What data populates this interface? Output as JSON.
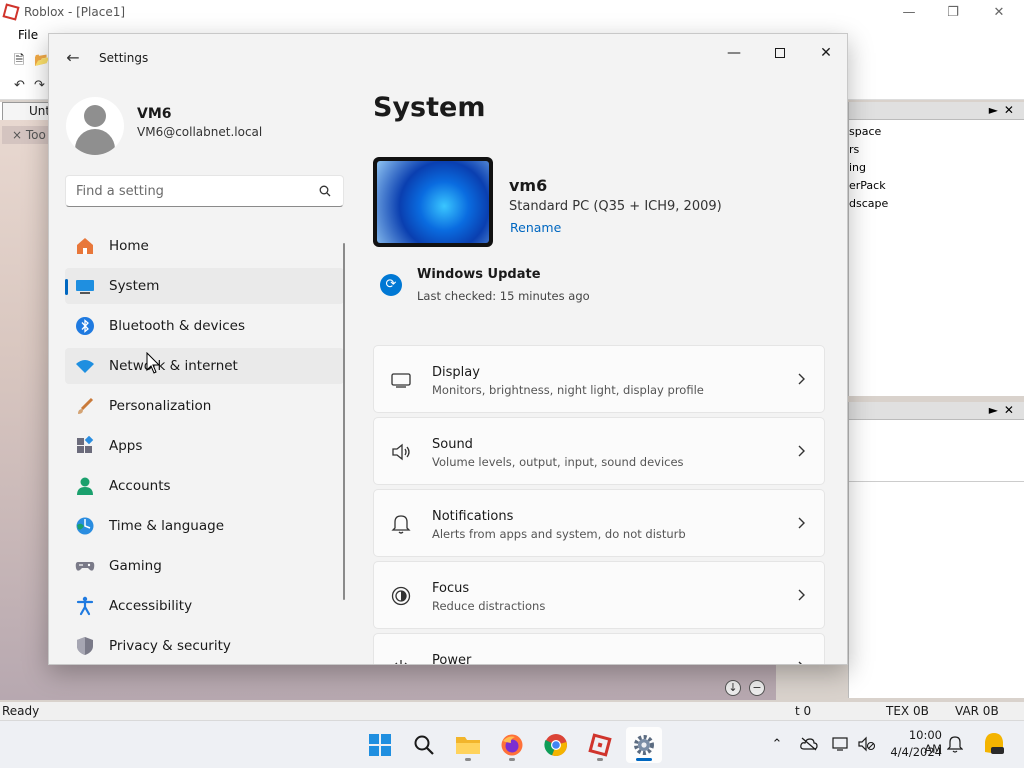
{
  "background_app": {
    "title": "Roblox - [Place1]",
    "menu": [
      "File"
    ],
    "tab_label": "Unt",
    "toolbox_tab": "× Too",
    "explorer_items": [
      "space",
      "rs",
      "ing",
      "erPack",
      "dscape"
    ],
    "status": {
      "ready": "Ready",
      "t": "t 0",
      "tex": "TEX 0B",
      "var": "VAR 0B"
    }
  },
  "settings": {
    "window_title": "Settings",
    "back_icon": "arrow-left-icon",
    "profile": {
      "name": "VM6",
      "email": "VM6@collabnet.local"
    },
    "search": {
      "placeholder": "Find a setting"
    },
    "nav": [
      {
        "label": "Home",
        "icon": "home-icon"
      },
      {
        "label": "System",
        "icon": "system-icon",
        "selected": true
      },
      {
        "label": "Bluetooth & devices",
        "icon": "bluetooth-icon"
      },
      {
        "label": "Network & internet",
        "icon": "wifi-icon",
        "hover": true
      },
      {
        "label": "Personalization",
        "icon": "brush-icon"
      },
      {
        "label": "Apps",
        "icon": "apps-icon"
      },
      {
        "label": "Accounts",
        "icon": "accounts-icon"
      },
      {
        "label": "Time & language",
        "icon": "globe-clock-icon"
      },
      {
        "label": "Gaming",
        "icon": "gamepad-icon"
      },
      {
        "label": "Accessibility",
        "icon": "accessibility-icon"
      },
      {
        "label": "Privacy & security",
        "icon": "shield-icon"
      }
    ],
    "page": {
      "title": "System",
      "device_name": "vm6",
      "device_model": "Standard PC (Q35 + ICH9, 2009)",
      "rename": "Rename",
      "windows_update": {
        "title": "Windows Update",
        "subtitle": "Last checked: 15 minutes ago"
      },
      "cards": [
        {
          "title": "Display",
          "subtitle": "Monitors, brightness, night light, display profile",
          "icon": "monitor-icon"
        },
        {
          "title": "Sound",
          "subtitle": "Volume levels, output, input, sound devices",
          "icon": "speaker-icon"
        },
        {
          "title": "Notifications",
          "subtitle": "Alerts from apps and system, do not disturb",
          "icon": "bell-icon"
        },
        {
          "title": "Focus",
          "subtitle": "Reduce distractions",
          "icon": "focus-icon"
        },
        {
          "title": "Power",
          "subtitle": "",
          "icon": "power-icon"
        }
      ]
    }
  },
  "taskbar": {
    "apps": [
      "start-icon",
      "search-icon",
      "file-explorer-icon",
      "firefox-icon",
      "chrome-icon",
      "roblox-studio-icon",
      "settings-icon"
    ],
    "clock": {
      "time": "10:00 AM",
      "date": "4/4/2024"
    }
  },
  "colors": {
    "accent": "#0067c0",
    "settings_bg": "#f3f3f3"
  }
}
